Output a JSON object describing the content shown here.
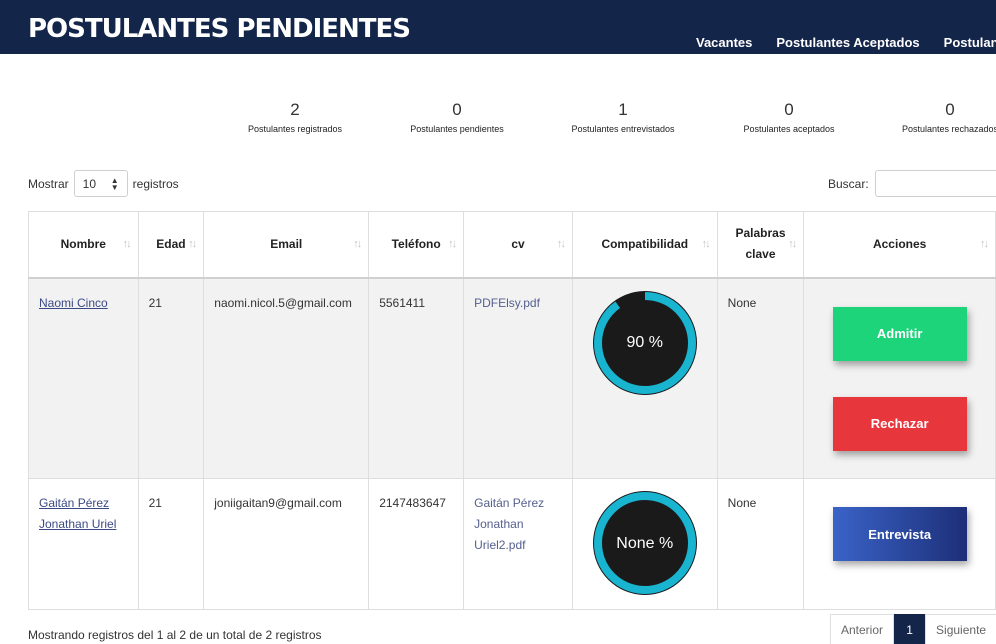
{
  "header": {
    "title": "POSTULANTES PENDIENTES",
    "nav": [
      "Vacantes",
      "Postulantes Aceptados",
      "Postulantes"
    ]
  },
  "stats": [
    {
      "value": "2",
      "label": "Postulantes registrados"
    },
    {
      "value": "0",
      "label": "Postulantes pendientes"
    },
    {
      "value": "1",
      "label": "Postulantes entrevistados"
    },
    {
      "value": "0",
      "label": "Postulantes aceptados"
    },
    {
      "value": "0",
      "label": "Postulantes rechazados"
    }
  ],
  "controls": {
    "show_label": "Mostrar",
    "page_size": "10",
    "records_label": "registros",
    "search_label": "Buscar:",
    "search_value": ""
  },
  "table": {
    "columns": [
      "Nombre",
      "Edad",
      "Email",
      "Teléfono",
      "cv",
      "Compatibilidad",
      "Palabras clave",
      "Acciones"
    ],
    "rows": [
      {
        "name": "Naomi Cinco",
        "age": "21",
        "email": "naomi.nicol.5@gmail.com",
        "phone": "5561411",
        "cv": "PDFElsy.pdf",
        "compat_label": "90 %",
        "compat_value": 90,
        "keywords": "None",
        "actions": [
          "Admitir",
          "Rechazar"
        ]
      },
      {
        "name": "Gaitán Pérez Jonathan Uriel",
        "age": "21",
        "email": "joniigaitan9@gmail.com",
        "phone": "2147483647",
        "cv": "Gaitán Pérez Jonathan Uriel2.pdf",
        "compat_label": "None %",
        "compat_value": 100,
        "keywords": "None",
        "actions": [
          "Entrevista"
        ]
      }
    ]
  },
  "footer": {
    "info": "Mostrando registros del 1 al 2 de un total de 2 registros",
    "prev": "Anterior",
    "page": "1",
    "next": "Siguiente"
  },
  "colors": {
    "header_bg": "#14254a",
    "gauge_ring": "#18b4d0",
    "admit": "#1dd47a",
    "reject": "#e8363d",
    "interview": "#3a63c8"
  }
}
